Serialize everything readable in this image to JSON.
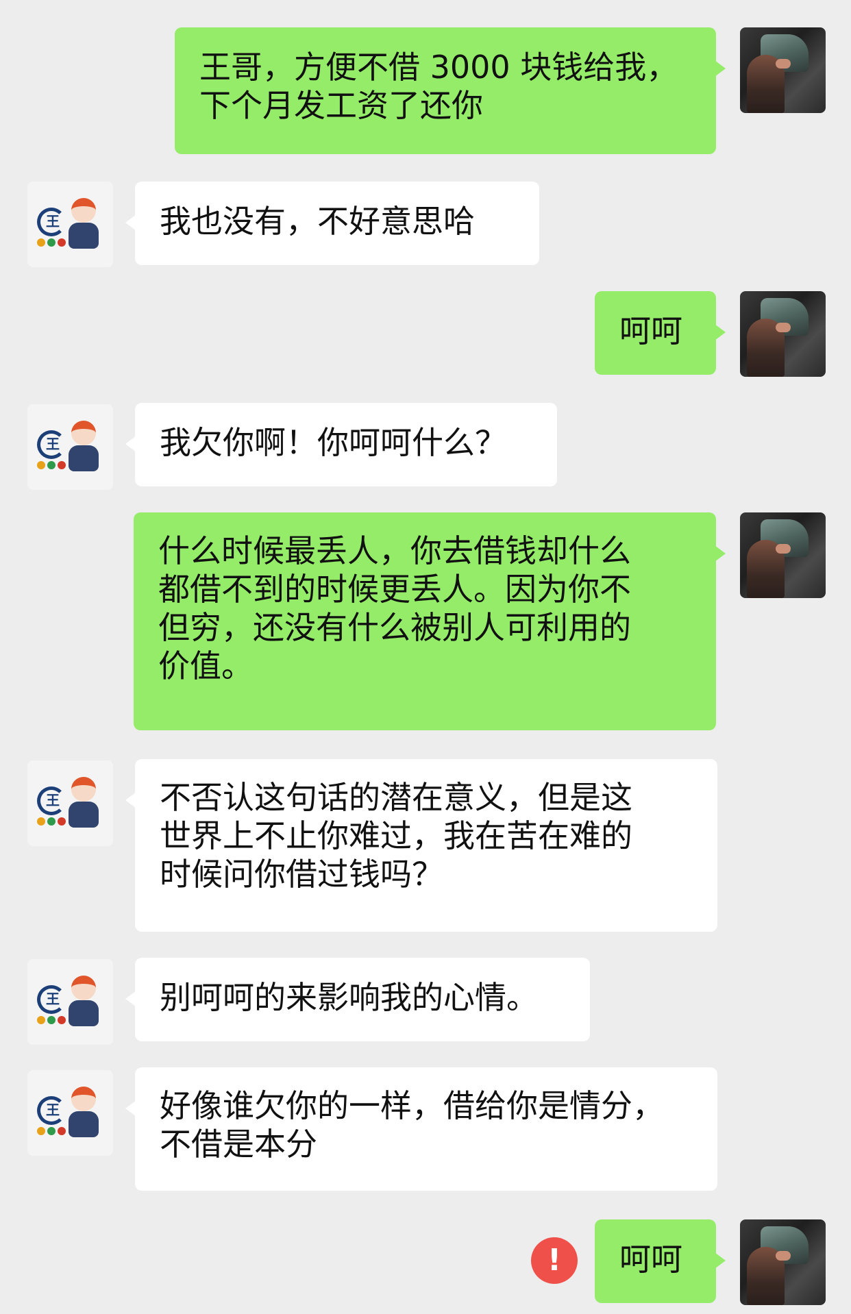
{
  "conversation": {
    "messages": [
      {
        "sender": "self",
        "text": "王哥，方便不借 3000 块钱给我，\n下个月发工资了还你"
      },
      {
        "sender": "other",
        "text": "我也没有，不好意思哈"
      },
      {
        "sender": "self",
        "text": "呵呵"
      },
      {
        "sender": "other",
        "text": "我欠你啊！你呵呵什么？"
      },
      {
        "sender": "self",
        "text": "什么时候最丢人，你去借钱却什么\n都借不到的时候更丢人。因为你不\n但穷，还没有什么被别人可利用的\n价值。"
      },
      {
        "sender": "other",
        "text": "不否认这句话的潜在意义，但是这\n世界上不止你难过，我在苦在难的\n时候问你借过钱吗？"
      },
      {
        "sender": "other",
        "text": "别呵呵的来影响我的心情。"
      },
      {
        "sender": "other",
        "text": "好像谁欠你的一样，借给你是情分，\n不借是本分"
      },
      {
        "sender": "self",
        "text": "呵呵",
        "send_failed": true
      }
    ]
  },
  "avatars": {
    "other_logo_text": "王",
    "other_dot_colors": [
      "#e8a21a",
      "#2f9a4a",
      "#d43a2a"
    ]
  },
  "status": {
    "error_symbol": "!"
  },
  "colors": {
    "self_bubble": "#95ec69",
    "other_bubble": "#ffffff",
    "background": "#ededed",
    "error": "#f0504a"
  }
}
